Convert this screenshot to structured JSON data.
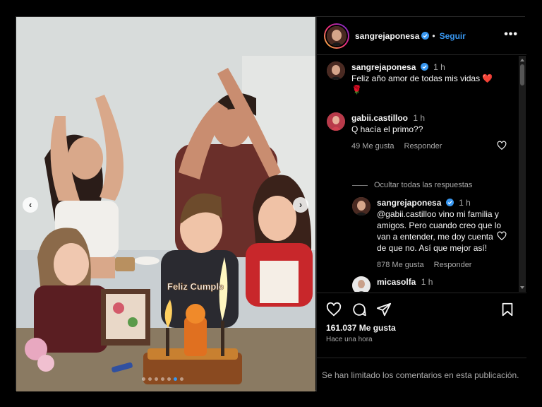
{
  "post": {
    "author": "sangrejaponesa",
    "follow_label": "Seguir",
    "dot": "•",
    "more_label": "•••",
    "photo_cake_text": "Feliz Cumple",
    "carousel": {
      "slide_count": 7,
      "active_index": 5
    }
  },
  "comments": [
    {
      "username": "sangrejaponesa",
      "time": "1 h",
      "text": "Feliz año amor de todas mis vidas ❤️🌹",
      "verified": true
    },
    {
      "username": "gabii.castilloo",
      "time": "1 h",
      "text": "Q hacía el primo??",
      "likes": "49 Me gusta",
      "reply_label": "Responder"
    },
    {
      "username": "sangrejaponesa",
      "time": "1 h",
      "text": "@gabii.castilloo vino mi familia y amigos. Pero cuando creo que lo van a entender, me doy cuenta de que no. Así que mejor así!",
      "likes": "878 Me gusta",
      "reply_label": "Responder",
      "verified": true
    },
    {
      "username": "micasolfa",
      "time": "1 h"
    }
  ],
  "hide_replies_label": "Ocultar todas las respuestas",
  "actions": {
    "likes": "161.037 Me gusta",
    "posted": "Hace una hora"
  },
  "footer": {
    "limited_text": "Se han limitado los comentarios en esta publicación."
  },
  "colors": {
    "accent": "#3897f0",
    "verified": "#3897f0",
    "background": "#000000",
    "muted_text": "#a8a8a8"
  }
}
